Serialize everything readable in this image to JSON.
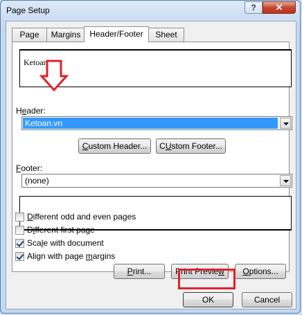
{
  "window": {
    "title": "Page Setup",
    "help_label": "?",
    "close_label": "✕"
  },
  "tabs": [
    {
      "label": "Page",
      "active": false
    },
    {
      "label": "Margins",
      "active": false
    },
    {
      "label": "Header/Footer",
      "active": true
    },
    {
      "label": "Sheet",
      "active": false
    }
  ],
  "header_preview": {
    "text": "Ketoan.vn"
  },
  "header": {
    "label_pre": "H",
    "label_accel": "e",
    "label_post": "ader:",
    "value": "Ketoan.vn"
  },
  "buttons": {
    "custom_header_accel": "C",
    "custom_header_rest": "ustom Header...",
    "custom_footer_accel": "U",
    "custom_footer_pre": "C",
    "custom_footer_rest": "stom Footer...",
    "print_pre": "",
    "print_accel": "P",
    "print_rest": "rint...",
    "print_preview_pre": "Print Previe",
    "print_preview_accel": "w",
    "print_preview_rest": "",
    "options_accel": "O",
    "options_rest": "ptions...",
    "ok": "OK",
    "cancel": "Cancel"
  },
  "footer": {
    "label_accel": "F",
    "label_rest": "ooter:",
    "value": "(none)"
  },
  "checkboxes": [
    {
      "pre": "",
      "accel": "D",
      "rest": "ifferent odd and even pages",
      "checked": false
    },
    {
      "pre": "D",
      "accel": "i",
      "rest": "fferent first page",
      "checked": false
    },
    {
      "pre": "Sca",
      "accel": "l",
      "rest": "e with document",
      "checked": true
    },
    {
      "pre": "Align with page ",
      "accel": "m",
      "rest": "argins",
      "checked": true
    }
  ],
  "annotation_color": "#e0202a"
}
